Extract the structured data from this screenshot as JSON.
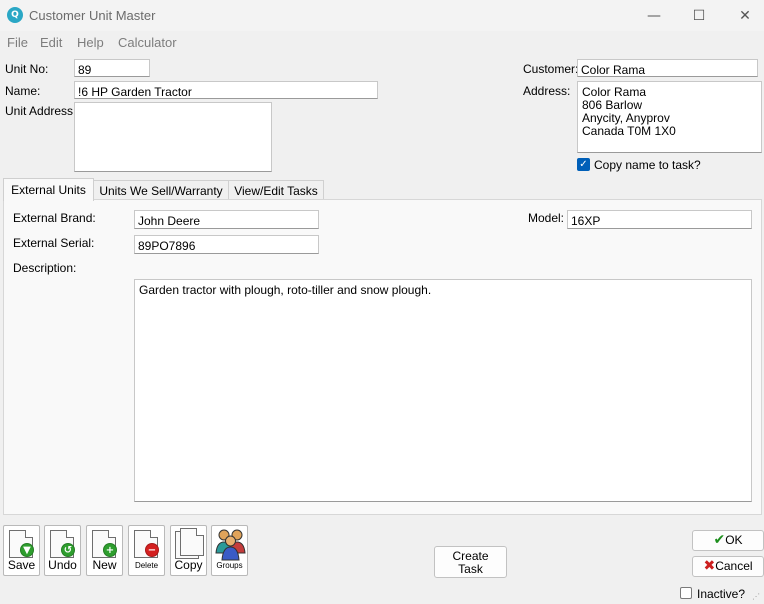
{
  "window": {
    "title": "Customer Unit Master",
    "icon_letter": "Q",
    "controls": {
      "minimize": "—",
      "maximize": "☐",
      "close": "✕"
    }
  },
  "menu": [
    "File",
    "Edit",
    "Help",
    "Calculator"
  ],
  "header": {
    "unit_no_label": "Unit No:",
    "unit_no_value": "89",
    "name_label": "Name:",
    "name_value": "!6 HP Garden Tractor",
    "unit_address_label": "Unit Address:",
    "unit_address_value": "",
    "customer_label": "Customer:",
    "customer_value": "Color Rama",
    "address_label": "Address:",
    "address_lines": [
      "Color Rama",
      "806 Barlow",
      "Anycity,  Anyprov",
      "Canada  T0M 1X0"
    ],
    "copy_name_label": "Copy name to task?",
    "copy_name_checked": true
  },
  "tabs": [
    {
      "label": "External Units",
      "active": true
    },
    {
      "label": "Units We Sell/Warranty",
      "active": false
    },
    {
      "label": "View/Edit Tasks",
      "active": false
    }
  ],
  "external_units": {
    "brand_label": "External Brand:",
    "brand_value": "John Deere",
    "serial_label": "External Serial:",
    "serial_value": "89PO7896",
    "model_label": "Model:",
    "model_value": "16XP",
    "description_label": "Description:",
    "description_value": "Garden tractor with plough, roto-tiller and snow plough."
  },
  "toolbar": {
    "save": "Save",
    "undo": "Undo",
    "new": "New",
    "delete": "Delete",
    "copy": "Copy",
    "groups": "Groups"
  },
  "buttons": {
    "create_task_line1": "Create",
    "create_task_line2": "Task",
    "ok": "OK",
    "cancel": "Cancel",
    "inactive": "Inactive?"
  },
  "colors": {
    "accent": "#005fb8",
    "save_badge": "#2e9e2e",
    "undo_badge": "#2e9e2e",
    "new_badge": "#2e9e2e",
    "delete_badge": "#d42020",
    "ok_check": "#1d8f1d",
    "cancel_x": "#cc1f1f"
  }
}
